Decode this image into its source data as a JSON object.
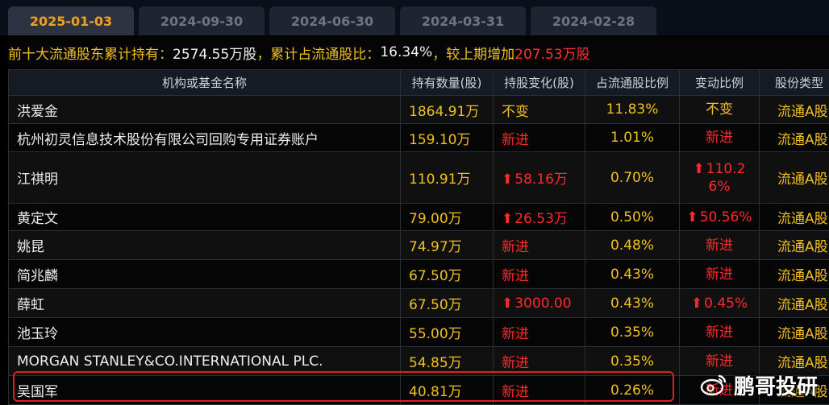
{
  "tabs": [
    {
      "label": "2025-01-03",
      "active": true
    },
    {
      "label": "2024-09-30",
      "active": false
    },
    {
      "label": "2024-06-30",
      "active": false
    },
    {
      "label": "2024-03-31",
      "active": false
    },
    {
      "label": "2024-02-28",
      "active": false
    }
  ],
  "summary": {
    "prefix": "前十大流通股东累计持有：",
    "total_shares": "2574.55万股",
    "ratio_label": "，累计占流通股比：",
    "ratio": "16.34%",
    "change_label": "，较上期增加",
    "change_value": "207.53万股"
  },
  "columns": [
    "机构或基金名称",
    "持有数量(股)",
    "持股变化(股)",
    "占流通股比例",
    "变动比例",
    "股份类型"
  ],
  "rows": [
    {
      "name": "洪爱金",
      "shares": "1864.91万",
      "change": "不变",
      "change_color": "yellow",
      "change_arrow": false,
      "pct": "11.83%",
      "ratio": "不变",
      "ratio_color": "yellow",
      "ratio_arrow": false,
      "type": "流通A股"
    },
    {
      "name": "杭州初灵信息技术股份有限公司回购专用证券账户",
      "shares": "159.10万",
      "change": "新进",
      "change_color": "red",
      "change_arrow": false,
      "pct": "1.01%",
      "ratio": "新进",
      "ratio_color": "red",
      "ratio_arrow": false,
      "type": "流通A股"
    },
    {
      "name": "江祺明",
      "shares": "110.91万",
      "change": "58.16万",
      "change_color": "red",
      "change_arrow": true,
      "pct": "0.70%",
      "ratio": "110.26%",
      "ratio_color": "red",
      "ratio_arrow": true,
      "type": "流通A股",
      "tall": true
    },
    {
      "name": "黄定文",
      "shares": "79.00万",
      "change": "26.53万",
      "change_color": "red",
      "change_arrow": true,
      "pct": "0.50%",
      "ratio": "50.56%",
      "ratio_color": "red",
      "ratio_arrow": true,
      "type": "流通A股"
    },
    {
      "name": "姚昆",
      "shares": "74.97万",
      "change": "新进",
      "change_color": "red",
      "change_arrow": false,
      "pct": "0.48%",
      "ratio": "新进",
      "ratio_color": "red",
      "ratio_arrow": false,
      "type": "流通A股"
    },
    {
      "name": "简兆麟",
      "shares": "67.50万",
      "change": "新进",
      "change_color": "red",
      "change_arrow": false,
      "pct": "0.43%",
      "ratio": "新进",
      "ratio_color": "red",
      "ratio_arrow": false,
      "type": "流通A股"
    },
    {
      "name": "薛虹",
      "shares": "67.50万",
      "change": "3000.00",
      "change_color": "red",
      "change_arrow": true,
      "pct": "0.43%",
      "ratio": "0.45%",
      "ratio_color": "red",
      "ratio_arrow": true,
      "type": "流通A股"
    },
    {
      "name": "池玉玲",
      "shares": "55.00万",
      "change": "新进",
      "change_color": "red",
      "change_arrow": false,
      "pct": "0.35%",
      "ratio": "新进",
      "ratio_color": "red",
      "ratio_arrow": false,
      "type": "流通A股"
    },
    {
      "name": "MORGAN STANLEY&CO.INTERNATIONAL PLC.",
      "shares": "54.85万",
      "change": "新进",
      "change_color": "red",
      "change_arrow": false,
      "pct": "0.35%",
      "ratio": "新进",
      "ratio_color": "red",
      "ratio_arrow": false,
      "type": "流通A股"
    },
    {
      "name": "吴国军",
      "shares": "40.81万",
      "change": "新进",
      "change_color": "red",
      "change_arrow": false,
      "pct": "0.26%",
      "ratio": "新进",
      "ratio_color": "red",
      "ratio_arrow": false,
      "type": "流通A股"
    }
  ],
  "watermark": {
    "text": "鹏哥投研",
    "icon": "weibo-icon"
  },
  "colors": {
    "accent": "#f0c020",
    "increase": "#ff2a2a",
    "highlight_border": "#e02020"
  }
}
